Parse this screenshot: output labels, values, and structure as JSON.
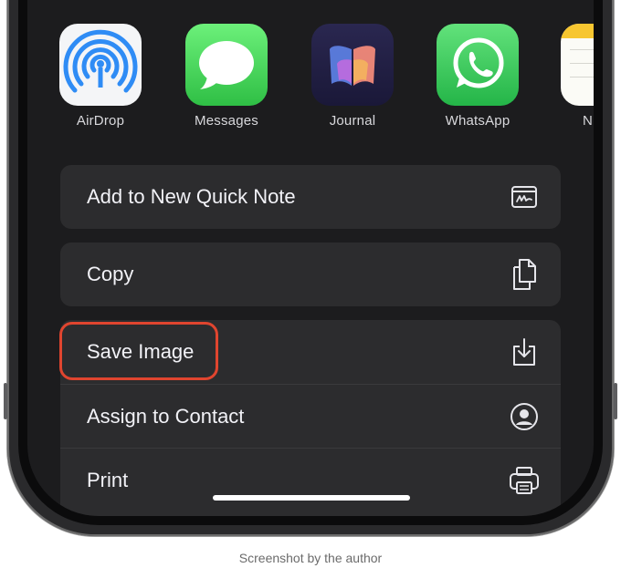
{
  "apps": [
    {
      "label": "AirDrop",
      "icon": "airdrop-icon"
    },
    {
      "label": "Messages",
      "icon": "messages-icon"
    },
    {
      "label": "Journal",
      "icon": "journal-icon"
    },
    {
      "label": "WhatsApp",
      "icon": "whatsapp-icon"
    },
    {
      "label": "N",
      "icon": "notes-icon"
    }
  ],
  "actions": {
    "quick_note": {
      "label": "Add to New Quick Note",
      "icon": "quick-note-icon"
    },
    "copy": {
      "label": "Copy",
      "icon": "copy-icon"
    },
    "save_image": {
      "label": "Save Image",
      "icon": "save-image-icon"
    },
    "assign_contact": {
      "label": "Assign to Contact",
      "icon": "person-circle-icon"
    },
    "print": {
      "label": "Print",
      "icon": "printer-icon"
    }
  },
  "colors": {
    "sheet_background": "#1c1c1e",
    "card_background": "#2c2c2e",
    "highlight": "#e0452f"
  },
  "caption": "Screenshot by the author"
}
